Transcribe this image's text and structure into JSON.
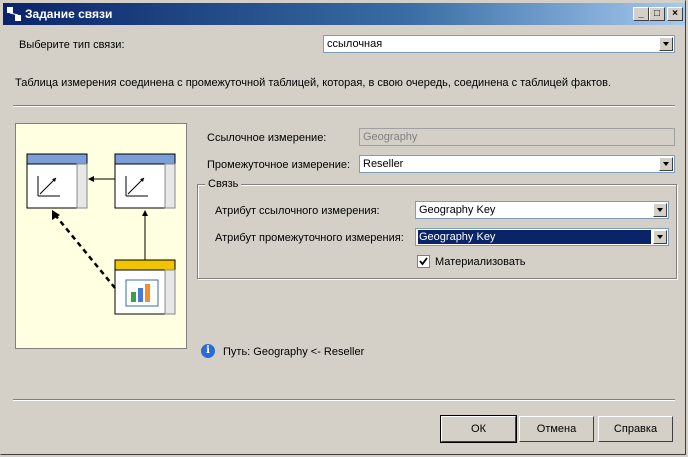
{
  "window": {
    "title": "Задание связи"
  },
  "relationship_type": {
    "label": "Выберите тип связи:",
    "value": "ссылочная"
  },
  "description": "Таблица измерения соединена с промежуточной таблицей, которая, в свою очередь, соединена с таблицей фактов.",
  "reference_dimension": {
    "label": "Ссылочное измерение:",
    "value": "Geography"
  },
  "intermediate_dimension": {
    "label": "Промежуточное измерение:",
    "value": "Reseller"
  },
  "relationship_group": {
    "title": "Связь",
    "reference_attribute": {
      "label": "Атрибут ссылочного измерения:",
      "value": "Geography Key"
    },
    "intermediate_attribute": {
      "label": "Атрибут промежуточного измерения:",
      "value": "Geography Key"
    },
    "materialize": {
      "label": "Материализовать",
      "checked": true
    }
  },
  "path": "Путь: Geography <- Reseller",
  "buttons": {
    "ok": "ОК",
    "cancel": "Отмена",
    "help": "Справка"
  },
  "colors": {
    "title_bar": "#0a246a",
    "diagram_bg": "#ffffe1",
    "selection": "#0a246a"
  }
}
